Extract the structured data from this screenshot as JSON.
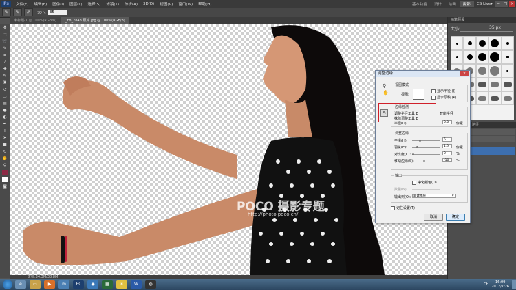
{
  "menubar": {
    "logo": "Ps",
    "items": [
      "文件(F)",
      "编辑(E)",
      "图像(I)",
      "图层(L)",
      "选择(S)",
      "滤镜(T)",
      "分析(A)",
      "3D(D)",
      "视图(V)",
      "窗口(W)",
      "帮助(H)"
    ],
    "workspaces": [
      "基本功能",
      "设计",
      "绘画",
      "摄影"
    ],
    "cs_live": "CS Live▾"
  },
  "options": {
    "size_label": "大小:",
    "size_value": "35"
  },
  "tabs": [
    "未标题-1 @ 100%(RGB/8)",
    "_F8_7848 原片.jpg @ 100%(RGB/8)"
  ],
  "status": {
    "doc": "文档:34.3M/38.8M"
  },
  "brush_panel": {
    "title": "画笔预设",
    "size_label": "大小:",
    "size_value": "35 px"
  },
  "layers_panel": {
    "tabs": [
      "图层",
      "通道",
      "路径"
    ]
  },
  "dialog": {
    "title": "调整边缘",
    "view_mode": {
      "legend": "视图模式",
      "view_label": "视图:",
      "show_radius": "显示半径 (J)",
      "show_original": "显示原稿 (P)"
    },
    "edge_detection": {
      "legend": "边缘检测",
      "tool1": "调整半径工具",
      "key1": "E",
      "tool2": "抹除调整工具",
      "key2": "E",
      "smart_radius": "智能半径",
      "radius_label": "半径(U):",
      "radius_value": "0.0",
      "radius_unit": "像素"
    },
    "adjust_edge": {
      "legend": "调整边缘",
      "smooth_label": "平滑(H):",
      "smooth_value": "5",
      "feather_label": "羽化(E):",
      "feather_value": "1.9",
      "feather_unit": "像素",
      "contrast_label": "对比度(C):",
      "contrast_value": "0",
      "contrast_unit": "%",
      "shift_label": "移动边缘(S):",
      "shift_value": "-10",
      "shift_unit": "%"
    },
    "output": {
      "legend": "输出",
      "decontaminate": "净化颜色(D)",
      "amount_label": "数量(N):",
      "output_to_label": "输出到(O):",
      "output_to_value": "新建图层"
    },
    "remember": "记住设置(T)",
    "cancel": "取消",
    "ok": "确定"
  },
  "watermark": {
    "brand": "POCO 摄影专题",
    "url": "http://photo.poco.cn/"
  },
  "taskbar": {
    "time": "16:09",
    "date": "2012/7/26",
    "lang": "CH"
  }
}
